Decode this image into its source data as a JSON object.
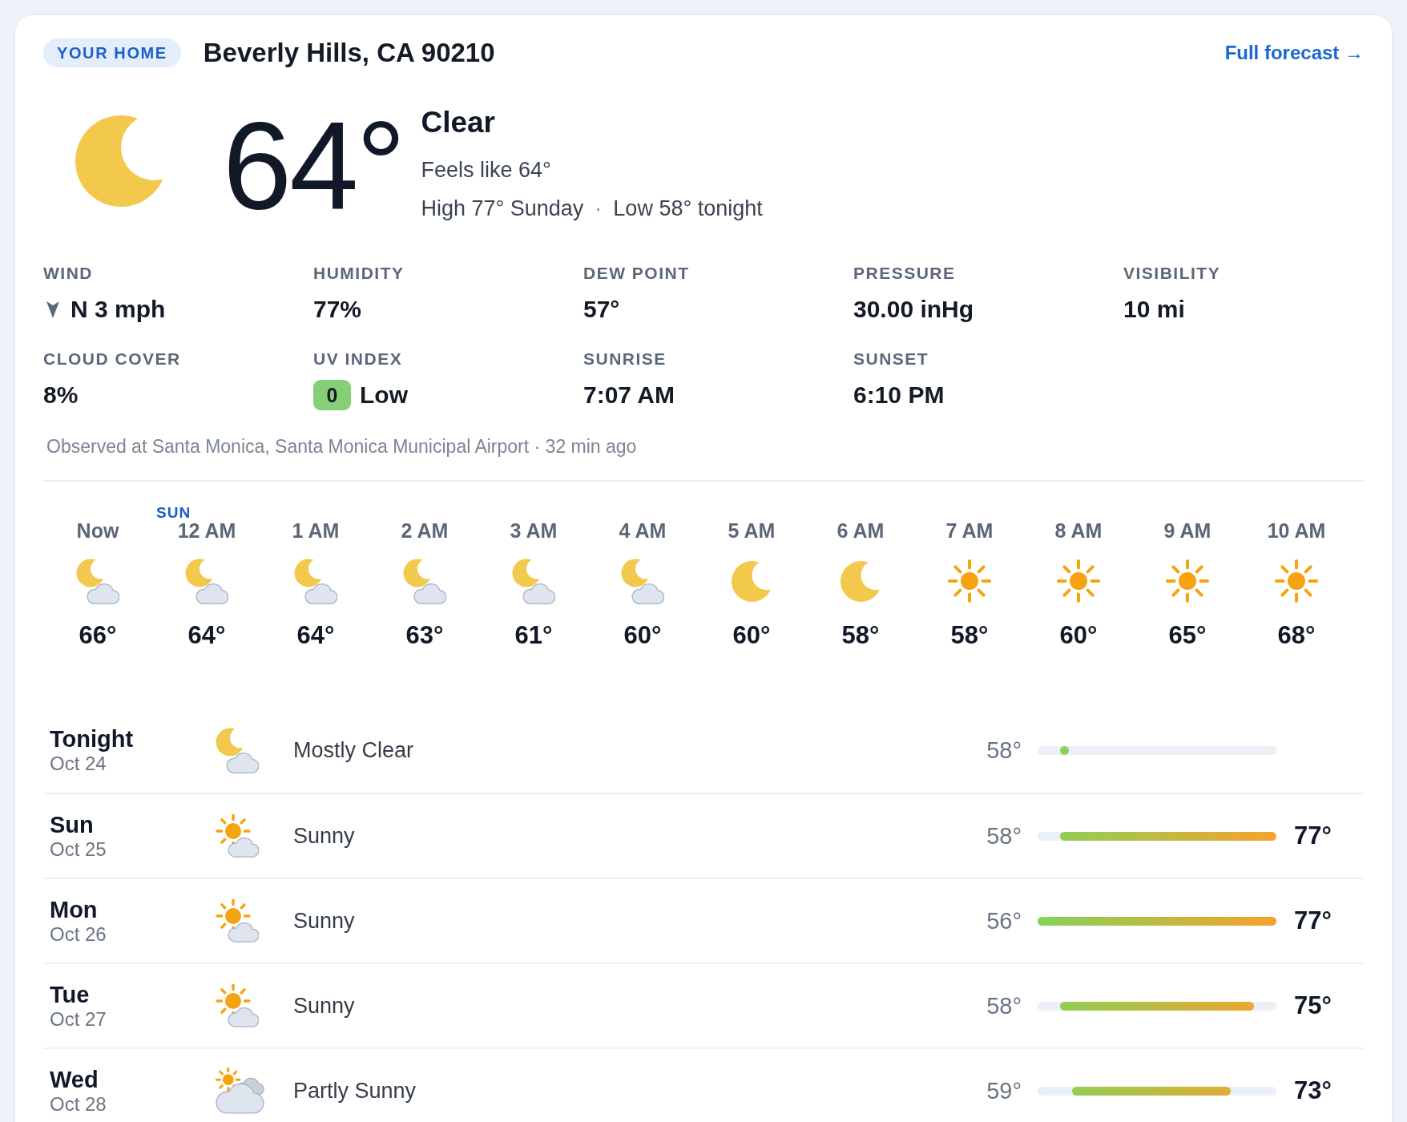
{
  "header": {
    "badge": "YOUR HOME",
    "location": "Beverly Hills, CA 90210",
    "link": "Full forecast →"
  },
  "current": {
    "temperature": "64°",
    "condition": "Clear",
    "feels_like": "Feels like 64°",
    "high": "High 77° Sunday",
    "separator": "·",
    "low": "Low 58° tonight"
  },
  "details": [
    {
      "kind": "wind",
      "label": "WIND",
      "value": "N 3 mph"
    },
    {
      "kind": "plain",
      "label": "HUMIDITY",
      "value": "77%"
    },
    {
      "kind": "plain",
      "label": "DEW POINT",
      "value": "57°"
    },
    {
      "kind": "plain",
      "label": "PRESSURE",
      "value": "30.00 inHg"
    },
    {
      "kind": "plain",
      "label": "VISIBILITY",
      "value": "10 mi"
    },
    {
      "kind": "plain",
      "label": "CLOUD COVER",
      "value": "8%"
    },
    {
      "kind": "uv",
      "label": "UV INDEX",
      "index": "0",
      "value": "Low"
    },
    {
      "kind": "plain",
      "label": "SUNRISE",
      "value": "7:07 AM"
    },
    {
      "kind": "plain",
      "label": "SUNSET",
      "value": "6:10 PM"
    }
  ],
  "observation": "Observed at Santa Monica, Santa Monica Municipal Airport · 32 min ago",
  "hourly": [
    {
      "time": "Now",
      "kind": "mooncloud",
      "temperature": "66°"
    },
    {
      "day": "SUN",
      "time": "12 AM",
      "kind": "mooncloud",
      "temperature": "64°"
    },
    {
      "time": "1 AM",
      "kind": "mooncloud",
      "temperature": "64°"
    },
    {
      "time": "2 AM",
      "kind": "mooncloud",
      "temperature": "63°"
    },
    {
      "time": "3 AM",
      "kind": "mooncloud",
      "temperature": "61°"
    },
    {
      "time": "4 AM",
      "kind": "mooncloud",
      "temperature": "60°"
    },
    {
      "time": "5 AM",
      "kind": "moon",
      "temperature": "60°"
    },
    {
      "time": "6 AM",
      "kind": "moon",
      "temperature": "58°"
    },
    {
      "time": "7 AM",
      "kind": "sun",
      "temperature": "58°"
    },
    {
      "time": "8 AM",
      "kind": "sun",
      "temperature": "60°"
    },
    {
      "time": "9 AM",
      "kind": "sun",
      "temperature": "65°"
    },
    {
      "time": "10 AM",
      "kind": "sun",
      "temperature": "68°"
    }
  ],
  "daily": [
    {
      "day": "Tonight",
      "date": "Oct 24",
      "kind": "mooncloud",
      "condition": "Mostly Clear",
      "low": "58°"
    },
    {
      "day": "Sun",
      "date": "Oct 25",
      "kind": "suncloud",
      "condition": "Sunny",
      "low": "58°",
      "high": "77°"
    },
    {
      "day": "Mon",
      "date": "Oct 26",
      "kind": "suncloud",
      "condition": "Sunny",
      "low": "56°",
      "high": "77°"
    },
    {
      "day": "Tue",
      "date": "Oct 27",
      "kind": "suncloud",
      "condition": "Sunny",
      "low": "58°",
      "high": "75°"
    },
    {
      "day": "Wed",
      "date": "Oct 28",
      "kind": "partlysunny",
      "condition": "Partly Sunny",
      "low": "59°",
      "high": "73°"
    }
  ]
}
